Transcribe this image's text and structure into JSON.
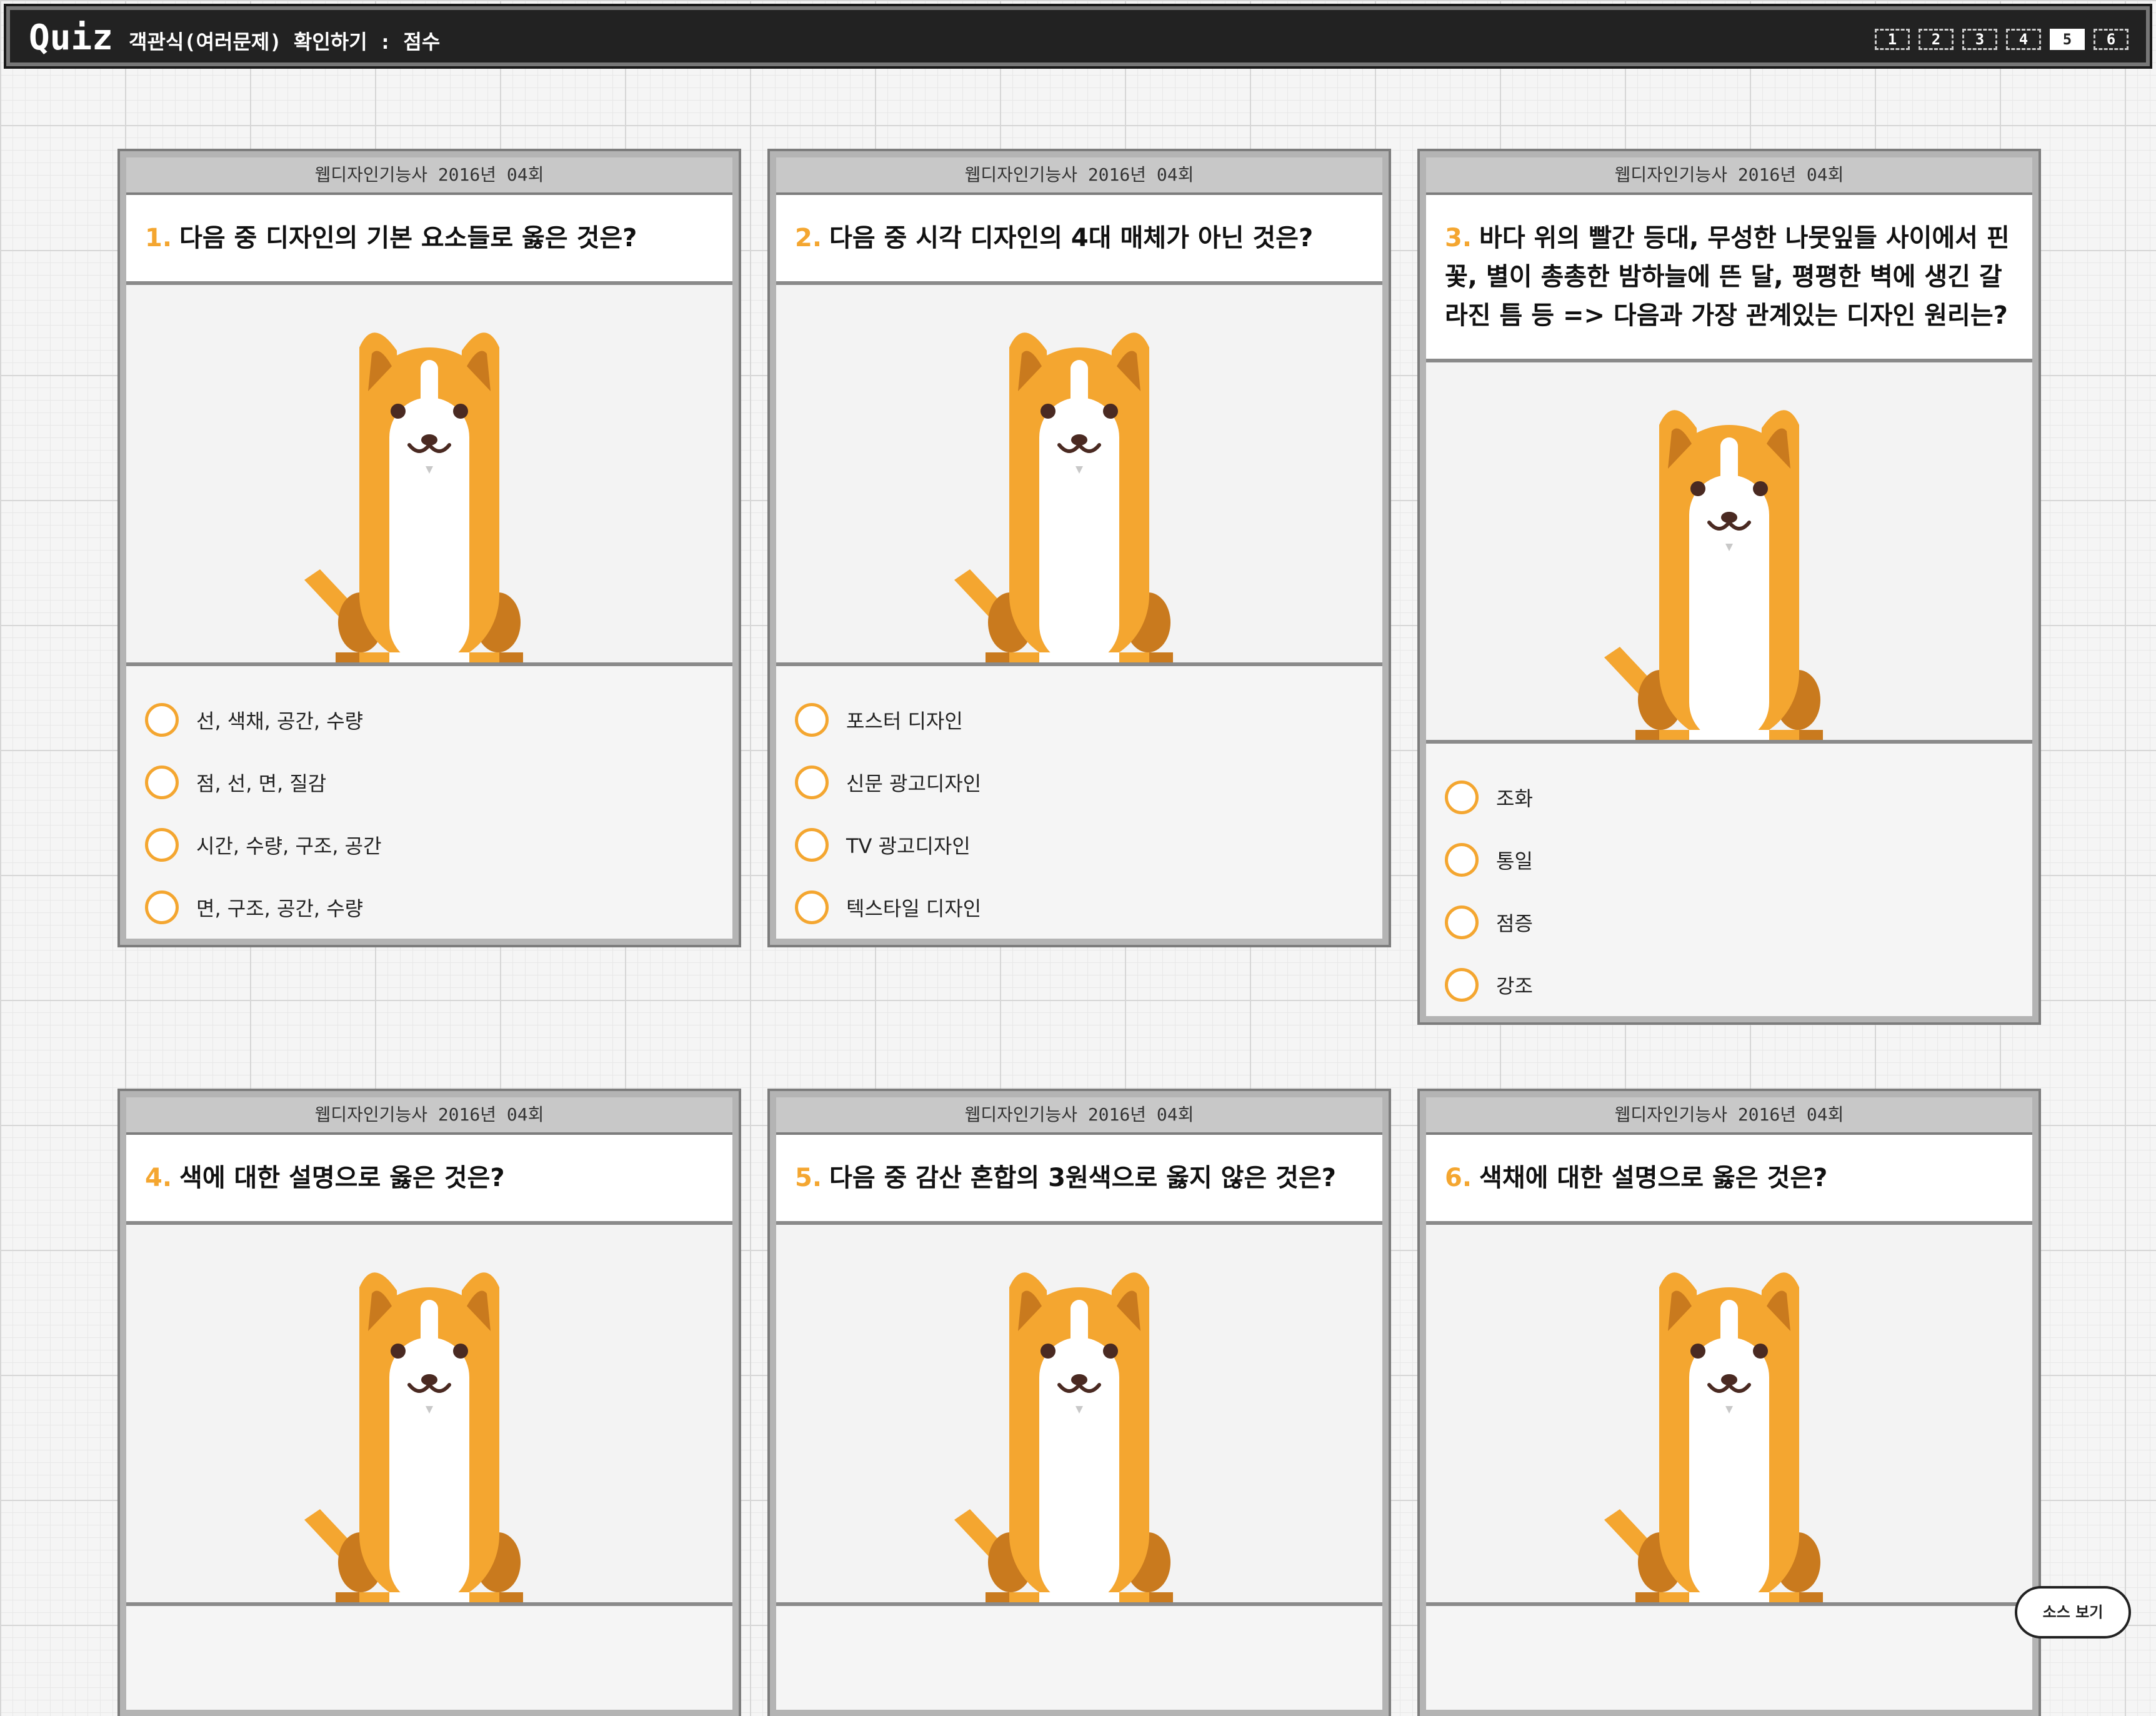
{
  "header": {
    "logo": "Quiz",
    "subtitle": "객관식(여러문제) 확인하기 : 점수",
    "pages": [
      "1",
      "2",
      "3",
      "4",
      "5",
      "6"
    ],
    "active_page": "5"
  },
  "cards": [
    {
      "meta": "웹디자인기능사 2016년 04회",
      "number": "1.",
      "question": "다음 중 디자인의 기본 요소들로 옳은 것은?",
      "image": "dog-illustration",
      "choices": [
        "선, 색채, 공간, 수량",
        "점, 선, 면, 질감",
        "시간, 수량, 구조, 공간",
        "면, 구조, 공간, 수량"
      ]
    },
    {
      "meta": "웹디자인기능사 2016년 04회",
      "number": "2.",
      "question": "다음 중 시각 디자인의 4대 매체가 아닌 것은?",
      "image": "dog-illustration",
      "choices": [
        "포스터 디자인",
        "신문 광고디자인",
        "TV 광고디자인",
        "텍스타일 디자인"
      ]
    },
    {
      "meta": "웹디자인기능사 2016년 04회",
      "number": "3.",
      "question": "바다 위의 빨간 등대, 무성한 나뭇잎들 사이에서 핀 꽃, 별이 총총한 밤하늘에 뜬 달, 평평한 벽에 생긴 갈라진 틈 등 => 다음과 가장 관계있는 디자인 원리는?",
      "image": "dog-illustration",
      "choices": [
        "조화",
        "통일",
        "점증",
        "강조"
      ]
    },
    {
      "meta": "웹디자인기능사 2016년 04회",
      "number": "4.",
      "question": "색에 대한 설명으로 옳은 것은?",
      "image": "dog-illustration",
      "choices": []
    },
    {
      "meta": "웹디자인기능사 2016년 04회",
      "number": "5.",
      "question": "다음 중 감산 혼합의 3원색으로 옳지 않은 것은?",
      "image": "dog-illustration",
      "choices": []
    },
    {
      "meta": "웹디자인기능사 2016년 04회",
      "number": "6.",
      "question": "색채에 대한 설명으로 옳은 것은?",
      "image": "dog-illustration",
      "choices": []
    }
  ],
  "source_button": "소스 보기",
  "colors": {
    "accent": "#f4a630",
    "header_bg": "#222222",
    "border_gray": "#b4b4b4"
  }
}
